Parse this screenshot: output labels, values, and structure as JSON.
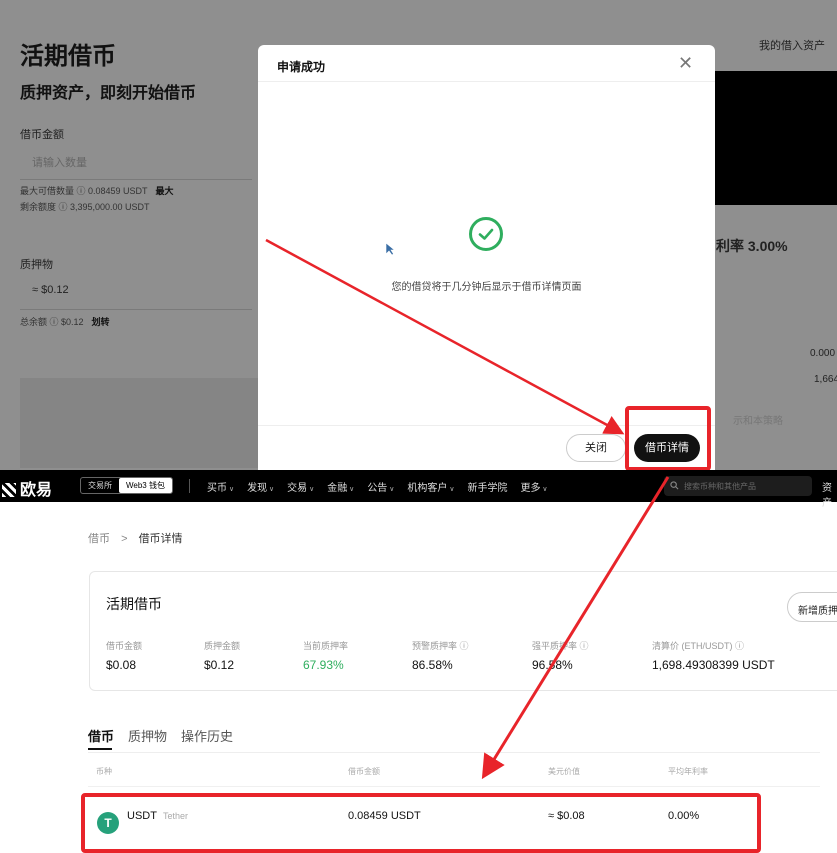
{
  "background": {
    "title": "活期借币",
    "subtitle": "质押资产，即刻开始借币",
    "borrow_amount_label": "借币金额",
    "borrow_placeholder": "请输入数量",
    "max_borrow": "最大可借数量 ⓘ 0.08459 USDT",
    "max_label": "最大",
    "remaining": "剩余额度 ⓘ 3,395,000.00 USDT",
    "collateral_label": "质押物",
    "collateral_value": "≈ $0.12",
    "total_balance": "总余额 ⓘ $0.12",
    "transfer": "划转",
    "my_borrowed": "我的借入资产",
    "rate_text": "利率 3.00%",
    "num1": "0.000",
    "num2": "1,664",
    "faint_text": "示和本策略"
  },
  "modal": {
    "title": "申请成功",
    "message": "您的借贷将于几分钟后显示于借币详情页面",
    "close_label": "关闭",
    "detail_label": "借币详情"
  },
  "nav": {
    "logo": "欧易",
    "tab_exchange": "交易所",
    "tab_web3": "Web3 钱包",
    "items": [
      "买币",
      "发现",
      "交易",
      "金融",
      "公告",
      "机构客户",
      "新手学院",
      "更多"
    ],
    "search_placeholder": "搜索币种和其他产品",
    "right": "资产"
  },
  "breadcrumb": {
    "root": "借币",
    "sep": ">",
    "current": "借币详情"
  },
  "card": {
    "title": "活期借币",
    "new_button": "新增质押物",
    "stats": [
      {
        "label": "借币金额",
        "value": "$0.08"
      },
      {
        "label": "质押金额",
        "value": "$0.12"
      },
      {
        "label": "当前质押率",
        "value": "67.93%"
      },
      {
        "label": "预警质押率 ⓘ",
        "value": "86.58%"
      },
      {
        "label": "强平质押率 ⓘ",
        "value": "96.58%"
      },
      {
        "label": "清算价 (ETH/USDT) ⓘ",
        "value": "1,698.49308399 USDT"
      }
    ]
  },
  "tabs": [
    "借币",
    "质押物",
    "操作历史"
  ],
  "table": {
    "headers": [
      "币种",
      "借币金额",
      "美元价值",
      "平均年利率"
    ],
    "row": {
      "coin": "USDT",
      "coin_full": "Tether",
      "amount": "0.08459 USDT",
      "usd": "≈ $0.08",
      "rate": "0.00%"
    }
  },
  "colors": {
    "highlight": "#e8242a",
    "success": "#2fae5e",
    "tether": "#26a17b"
  }
}
